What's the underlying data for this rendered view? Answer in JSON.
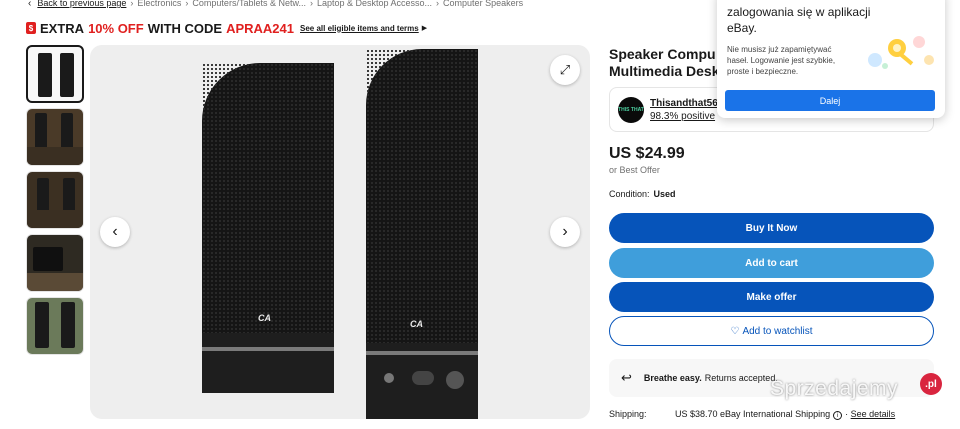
{
  "breadcrumb": {
    "back": "Back to previous page",
    "items": [
      "Electronics",
      "Computers/Tablets & Netw...",
      "Laptop & Desktop Accesso...",
      "Computer Speakers"
    ]
  },
  "promo": {
    "part1": "EXTRA",
    "part2": "10% OFF",
    "part3": "WITH CODE",
    "code": "APRAA241",
    "link": "See all eligible items and terms",
    "accent": "#e0201f"
  },
  "product": {
    "title_line1": "Speaker Compu",
    "title_line2": "Multimedia Desk"
  },
  "seller": {
    "avatar_text": "THIS THAT",
    "name": "Thisandthat564",
    "positive": "98.3% positive"
  },
  "price": {
    "value": "US $24.99",
    "best_offer": "or Best Offer"
  },
  "condition": {
    "label": "Condition:",
    "value": "Used"
  },
  "buttons": {
    "buy": "Buy It Now",
    "cart": "Add to cart",
    "offer": "Make offer",
    "watch": "Add to watchlist"
  },
  "breathe": {
    "bold": "Breathe easy.",
    "rest": "Returns accepted."
  },
  "shipping": {
    "label": "Shipping:",
    "cost": "US $38.70",
    "service": "eBay International Shipping",
    "details": "See details"
  },
  "popup": {
    "heading_line1": "zalogowania się w aplikacji",
    "heading_line2": "eBay.",
    "body": "Nie musisz już zapamiętywać haseł. Logowanie jest szybkie, proste i bezpieczne.",
    "button": "Dalej",
    "button_color": "#1a73e8"
  },
  "watermark": {
    "text": "Sprzedajemy",
    "suffix": ".pl"
  },
  "colors": {
    "primary_blue": "#0654ba",
    "secondary_blue": "#3f9edb"
  }
}
